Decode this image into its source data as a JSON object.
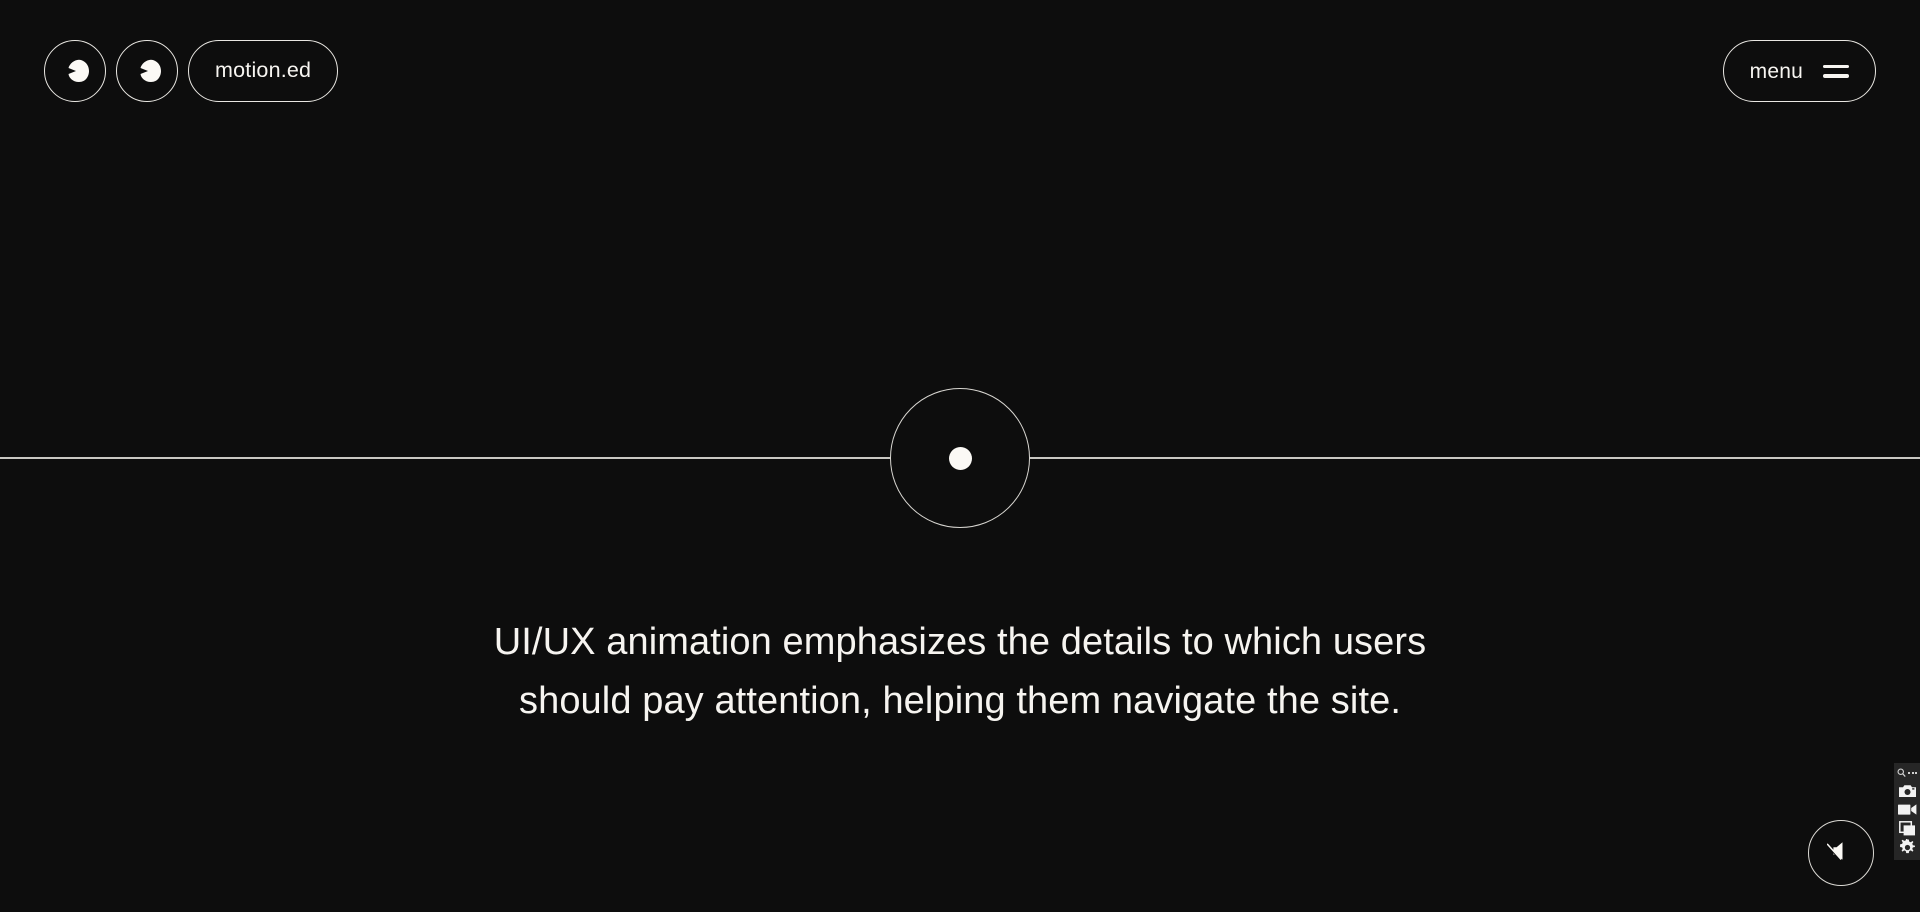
{
  "page": {
    "background_color": "#0d0d0d",
    "foreground_color": "#f6f4f0"
  },
  "header": {
    "brand": {
      "pill_label": "motion.ed",
      "eye_left_icon": "eye-pupil-icon",
      "eye_right_icon": "eye-pupil-icon"
    },
    "menu": {
      "label": "menu",
      "icon": "hamburger-icon"
    }
  },
  "hero": {
    "timeline": {
      "node_icon": "timeline-node-dot",
      "rule_color": "#c9c7c2"
    },
    "headline_lines": [
      "UI/UX animation emphasizes the details to which users",
      "should pay attention, helping them navigate the site."
    ]
  },
  "controls": {
    "sound_toggle": {
      "icon": "speaker-muted-icon",
      "state": "muted"
    }
  },
  "capture_toolbar": {
    "items": [
      {
        "icon": "pin-more-icon"
      },
      {
        "icon": "camera-icon"
      },
      {
        "icon": "video-camera-icon"
      },
      {
        "icon": "window-capture-icon"
      },
      {
        "icon": "gear-icon"
      }
    ]
  }
}
